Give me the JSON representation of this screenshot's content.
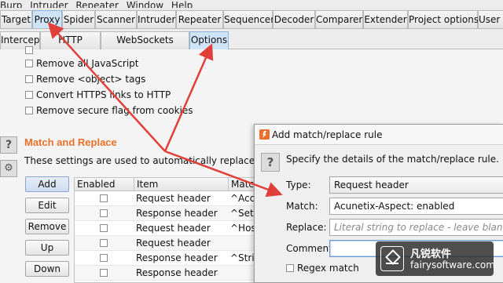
{
  "menu": {
    "items": [
      "Burp",
      "Intruder",
      "Repeater",
      "Window",
      "Help"
    ]
  },
  "tabs": [
    {
      "label": "Target"
    },
    {
      "label": "Proxy"
    },
    {
      "label": "Spider"
    },
    {
      "label": "Scanner"
    },
    {
      "label": "Intruder"
    },
    {
      "label": "Repeater"
    },
    {
      "label": "Sequencer"
    },
    {
      "label": "Decoder"
    },
    {
      "label": "Comparer"
    },
    {
      "label": "Extender"
    },
    {
      "label": "Project options"
    },
    {
      "label": "User o"
    }
  ],
  "subtabs": [
    {
      "label": "Intercept"
    },
    {
      "label": "HTTP history"
    },
    {
      "label": "WebSockets history"
    },
    {
      "label": "Options"
    }
  ],
  "options": [
    {
      "label": "Remove all JavaScript"
    },
    {
      "label": "Remove <object> tags"
    },
    {
      "label": "Convert HTTPS links to HTTP"
    },
    {
      "label": "Remove secure flag from cookies"
    }
  ],
  "match_replace": {
    "title": "Match and Replace",
    "description": "These settings are used to automatically replace parts of",
    "buttons": {
      "add": "Add",
      "edit": "Edit",
      "remove": "Remove",
      "up": "Up",
      "down": "Down"
    },
    "columns": {
      "enabled": "Enabled",
      "item": "Item",
      "match": "Matc"
    },
    "rows": [
      {
        "item": "Request header",
        "match": "^Acce"
      },
      {
        "item": "Response header",
        "match": "^Set-C"
      },
      {
        "item": "Request header",
        "match": "^Host"
      },
      {
        "item": "Request header",
        "match": ""
      },
      {
        "item": "Response header",
        "match": "^Stric"
      },
      {
        "item": "Response header",
        "match": ""
      }
    ]
  },
  "dialog": {
    "title": "Add match/replace rule",
    "intro": "Specify the details of the match/replace rule.",
    "type_label": "Type:",
    "type_value": "Request header",
    "match_label": "Match:",
    "match_value": "Acunetix-Aspect: enabled",
    "replace_label": "Replace:",
    "replace_placeholder": "Literal string to replace - leave blank to re",
    "comment_label": "Comment:",
    "comment_value": "",
    "regex_label": "Regex match"
  },
  "watermark": {
    "name": "凡锐软件",
    "site": "fairysoftware.com"
  },
  "colors": {
    "section_title": "#e8702a",
    "active_tab": "#cfe3f7",
    "arrow": "#e0403a"
  }
}
